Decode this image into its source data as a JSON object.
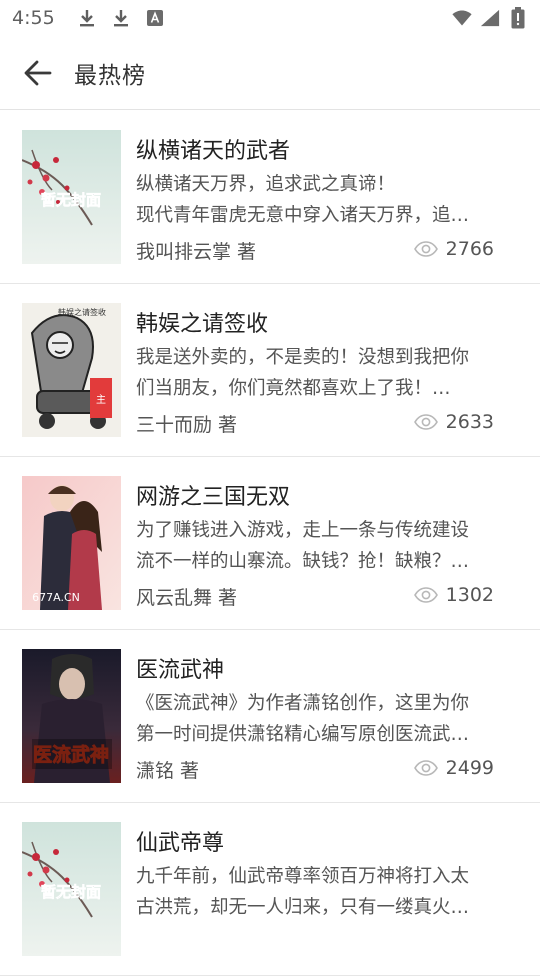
{
  "status_bar": {
    "time": "4:55",
    "icons": [
      "download-icon",
      "download-icon",
      "a-notification-icon",
      "wifi-icon",
      "signal-icon",
      "battery-icon"
    ]
  },
  "app_bar": {
    "title": "最热榜",
    "back_icon": "arrow-left-icon"
  },
  "books": [
    {
      "title": "纵横诸天的武者",
      "desc_line1": "纵横诸天万界，追求武之真谛！",
      "desc_line2": "现代青年雷虎无意中穿入诸天万界，追…",
      "author": "我叫排云掌 著",
      "views": "2766",
      "cover_text": "暂无封面"
    },
    {
      "title": "韩娱之请签收",
      "desc_line1": "我是送外卖的，不是卖的！没想到我把你",
      "desc_line2": "们当朋友，你们竟然都喜欢上了我！…",
      "author": "三十而励 著",
      "views": "2633",
      "cover_text": "韩娱之请签收"
    },
    {
      "title": "网游之三国无双",
      "desc_line1": "为了赚钱进入游戏，走上一条与传统建设",
      "desc_line2": "流不一样的山寨流。缺钱？抢！缺粮？…",
      "author": "风云乱舞 著",
      "views": "1302",
      "cover_text": "677A.CN"
    },
    {
      "title": "医流武神",
      "desc_line1": "《医流武神》为作者潇铭创作，这里为你",
      "desc_line2": "第一时间提供潇铭精心编写原创医流武…",
      "author": "潇铭 著",
      "views": "2499",
      "cover_text": "医流武神"
    },
    {
      "title": "仙武帝尊",
      "desc_line1": "九千年前，仙武帝尊率领百万神将打入太",
      "desc_line2": "古洪荒，却无一人归来，只有一缕真火…",
      "author": "",
      "views": "",
      "cover_text": "暂无封面"
    }
  ],
  "colors": {
    "divider": "#e6e6e6",
    "title_text": "#222222",
    "secondary_text": "#555555",
    "icon_gray": "#5f5f5f"
  }
}
